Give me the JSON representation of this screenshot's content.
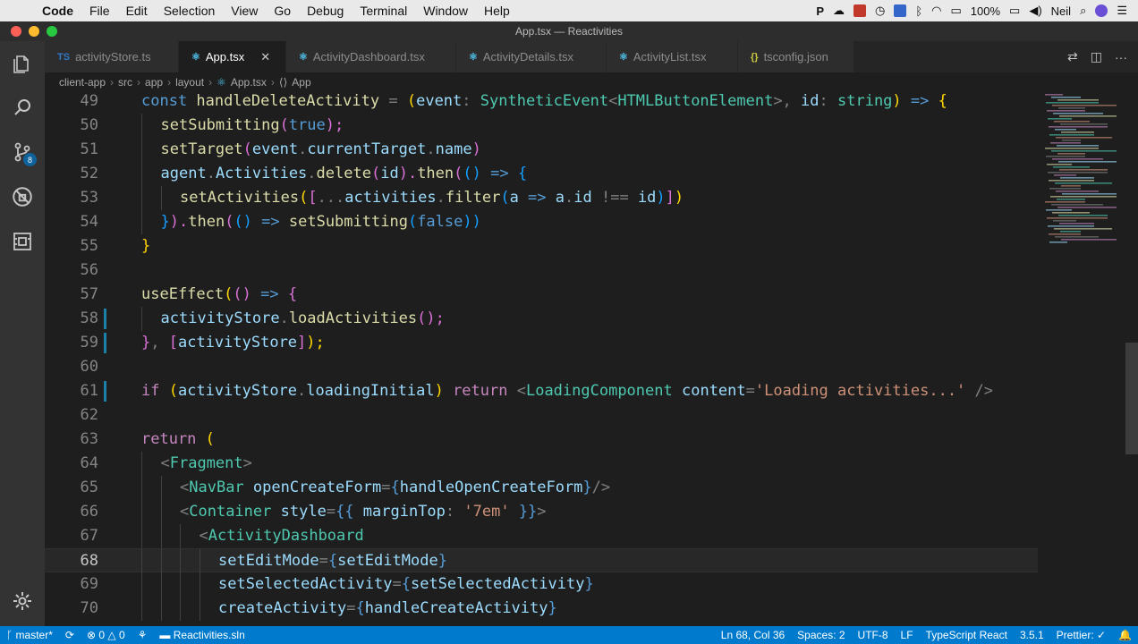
{
  "menubar": {
    "apple_icon": "apple-icon",
    "items": [
      "Code",
      "File",
      "Edit",
      "Selection",
      "View",
      "Go",
      "Debug",
      "Terminal",
      "Window",
      "Help"
    ],
    "battery": "100%",
    "user": "Neil"
  },
  "window": {
    "title": "App.tsx — Reactivities"
  },
  "tabs": [
    {
      "label": "activityStore.ts",
      "icon": "TS",
      "icon_color": "#3178c6"
    },
    {
      "label": "App.tsx",
      "icon": "⚛",
      "icon_color": "#4fc1e9",
      "active": true,
      "close": "✕"
    },
    {
      "label": "ActivityDashboard.tsx",
      "icon": "⚛",
      "icon_color": "#4fc1e9"
    },
    {
      "label": "ActivityDetails.tsx",
      "icon": "⚛",
      "icon_color": "#4fc1e9"
    },
    {
      "label": "ActivityList.tsx",
      "icon": "⚛",
      "icon_color": "#4fc1e9"
    },
    {
      "label": "tsconfig.json",
      "icon": "{}",
      "icon_color": "#cbcb41"
    }
  ],
  "breadcrumb": [
    "client-app",
    "src",
    "app",
    "layout",
    "App.tsx",
    "App"
  ],
  "sidebar": {
    "scm_badge": "8"
  },
  "editor": {
    "lines": [
      {
        "n": "49",
        "indent": 0
      },
      {
        "n": "50",
        "indent": 1
      },
      {
        "n": "51",
        "indent": 1
      },
      {
        "n": "52",
        "indent": 1
      },
      {
        "n": "53",
        "indent": 2
      },
      {
        "n": "54",
        "indent": 1
      },
      {
        "n": "55",
        "indent": 0
      },
      {
        "n": "56",
        "indent": 0
      },
      {
        "n": "57",
        "indent": 0
      },
      {
        "n": "58",
        "indent": 1,
        "git": true
      },
      {
        "n": "59",
        "indent": 0,
        "git": true
      },
      {
        "n": "60",
        "indent": 0
      },
      {
        "n": "61",
        "indent": 0,
        "git": true
      },
      {
        "n": "62",
        "indent": 0
      },
      {
        "n": "63",
        "indent": 0
      },
      {
        "n": "64",
        "indent": 1
      },
      {
        "n": "65",
        "indent": 2
      },
      {
        "n": "66",
        "indent": 2
      },
      {
        "n": "67",
        "indent": 3
      },
      {
        "n": "68",
        "indent": 4,
        "current": true
      },
      {
        "n": "69",
        "indent": 4
      },
      {
        "n": "70",
        "indent": 4
      }
    ],
    "code": {
      "l49": [
        "const ",
        "handleDeleteActivity",
        " = ",
        "(",
        "event",
        ": ",
        "SyntheticEvent",
        "<",
        "HTMLButtonElement",
        ">, ",
        "id",
        ": ",
        "string",
        ")",
        " => ",
        "{"
      ],
      "l50": [
        "setSubmitting",
        "(",
        "true",
        ");"
      ],
      "l51": [
        "setTarget",
        "(",
        "event",
        ".",
        "currentTarget",
        ".",
        "name",
        ")"
      ],
      "l52": [
        "agent",
        ".",
        "Activities",
        ".",
        "delete",
        "(",
        "id",
        ").",
        "then",
        "(",
        "()",
        " => ",
        "{"
      ],
      "l53": [
        "setActivities",
        "(",
        "[",
        "...",
        "activities",
        ".",
        "filter",
        "(",
        "a",
        " => ",
        "a",
        ".",
        "id",
        " !== ",
        "id",
        ")",
        "]",
        ")"
      ],
      "l54": [
        "}",
        ").",
        "then",
        "(",
        "()",
        " => ",
        "setSubmitting",
        "(",
        "false",
        "))"
      ],
      "l55": [
        "}"
      ],
      "l57": [
        "useEffect",
        "(",
        "()",
        " => ",
        "{"
      ],
      "l58": [
        "activityStore",
        ".",
        "loadActivities",
        "();"
      ],
      "l59": [
        "}",
        ", ",
        "[",
        "activityStore",
        "]",
        ");"
      ],
      "l61": [
        "if ",
        "(",
        "activityStore",
        ".",
        "loadingInitial",
        ") ",
        "return ",
        "<",
        "LoadingComponent",
        " ",
        "content",
        "=",
        "'Loading activities...'",
        " />"
      ],
      "l63": [
        "return ",
        "("
      ],
      "l64": [
        "<",
        "Fragment",
        ">"
      ],
      "l65": [
        "<",
        "NavBar",
        " ",
        "openCreateForm",
        "=",
        "{",
        "handleOpenCreateForm",
        "}",
        "/>"
      ],
      "l66": [
        "<",
        "Container",
        " ",
        "style",
        "=",
        "{{ ",
        "marginTop",
        ": ",
        "'7em'",
        " }}",
        ">"
      ],
      "l67": [
        "<",
        "ActivityDashboard"
      ],
      "l68": [
        "setEditMode",
        "=",
        "{",
        "setEditMode",
        "}"
      ],
      "l69": [
        "setSelectedActivity",
        "=",
        "{",
        "setSelectedActivity",
        "}"
      ],
      "l70": [
        "createActivity",
        "=",
        "{",
        "handleCreateActivity",
        "}"
      ]
    }
  },
  "statusbar": {
    "branch": "master*",
    "errors": "0",
    "warnings": "0",
    "solution": "Reactivities.sln",
    "position": "Ln 68, Col 36",
    "spaces": "Spaces: 2",
    "encoding": "UTF-8",
    "eol": "LF",
    "language": "TypeScript React",
    "ts_version": "3.5.1",
    "prettier": "Prettier: ✓"
  },
  "colors": {
    "accent": "#007acc",
    "editor_bg": "#1e1e1e"
  }
}
